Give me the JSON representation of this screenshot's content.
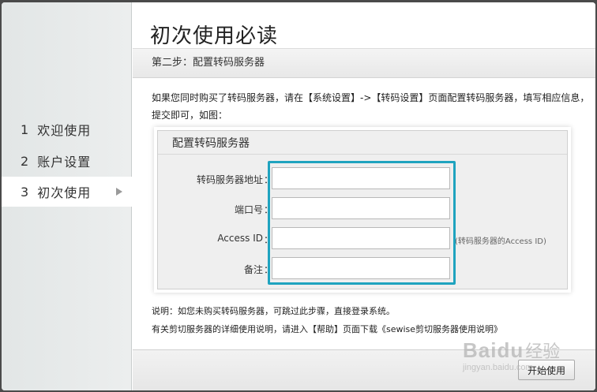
{
  "sidebar": {
    "items": [
      {
        "num": "1",
        "label": "欢迎使用"
      },
      {
        "num": "2",
        "label": "账户设置"
      },
      {
        "num": "3",
        "label": "初次使用"
      }
    ]
  },
  "main": {
    "title": "初次使用必读",
    "step": "第二步：配置转码服务器",
    "intro": "如果您同时购买了转码服务器，请在【系统设置】->【转码设置】页面配置转码服务器，填写相应信息，提交即可，如图：",
    "panel": {
      "title": "配置转码服务器",
      "fields": [
        {
          "label": "转码服务器地址",
          "value": ""
        },
        {
          "label": "端口号",
          "value": ""
        },
        {
          "label": "Access ID",
          "value": "",
          "hint": "(转码服务器的Access ID)"
        },
        {
          "label": "备注",
          "value": ""
        }
      ]
    },
    "note1": "说明：如您未购买转码服务器，可跳过此步骤，直接登录系统。",
    "note2": "有关剪切服务器的详细使用说明，请进入【帮助】页面下载《sewise剪切服务器使用说明》",
    "start_label": "开始使用"
  },
  "watermark": {
    "logo": "Baidu",
    "cn": "经验",
    "url": "jingyan.baidu.com"
  },
  "colors": {
    "highlight": "#1fa3bf",
    "sidebar_bg": "#e2e6e6"
  }
}
